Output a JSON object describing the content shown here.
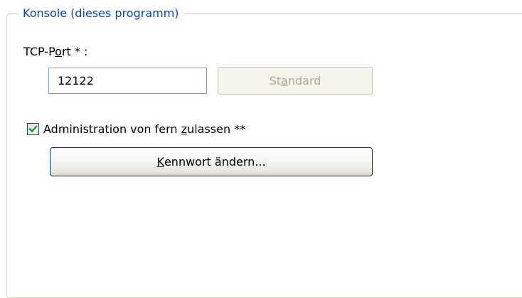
{
  "group": {
    "title": "Konsole (dieses programm)"
  },
  "tcp_port": {
    "label_before": "TCP-P",
    "label_mnemonic": "o",
    "label_after": "rt * :",
    "value": "12122"
  },
  "standard_button": {
    "label_before": "St",
    "label_mnemonic": "a",
    "label_after": "ndard"
  },
  "remote_admin": {
    "checked": true,
    "label_before": "Administration von fern ",
    "label_mnemonic": "z",
    "label_after": "ulassen **"
  },
  "change_password_button": {
    "label_before": "",
    "label_mnemonic": "K",
    "label_after": "ennwort ändern..."
  },
  "colors": {
    "group_title": "#0046d5",
    "checkmark": "#21a121",
    "disabled_text": "#aca899"
  },
  "icons": {
    "checkmark": "checkmark-icon"
  }
}
